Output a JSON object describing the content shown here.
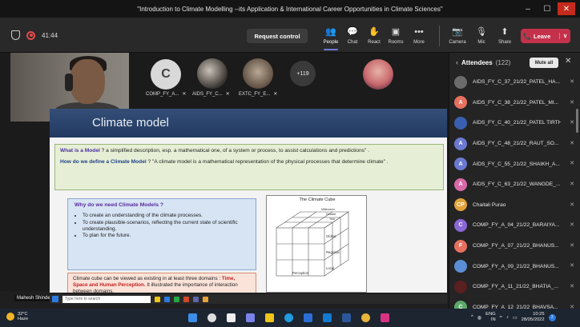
{
  "window": {
    "title": "\"Introduction to Climate Modelling --its Application & International Career Opportunities in Climate Sciences\"",
    "minimize": "–",
    "maximize": "☐",
    "close": "✕"
  },
  "toolbar": {
    "timer": "41:44",
    "request_control": "Request control",
    "items": [
      {
        "label": "People",
        "icon": "👥"
      },
      {
        "label": "Chat",
        "icon": "💬"
      },
      {
        "label": "React",
        "icon": "✋"
      },
      {
        "label": "Rooms",
        "icon": "▣"
      },
      {
        "label": "More",
        "icon": "•••"
      },
      {
        "label": "Camera",
        "icon": "📷"
      },
      {
        "label": "Mic",
        "icon": "🎙"
      },
      {
        "label": "Share",
        "icon": "⬆"
      }
    ],
    "leave": "Leave",
    "leave_icon": "📞",
    "leave_dropdown": "∨"
  },
  "stage": {
    "tiles": [
      {
        "initial": "C",
        "label": "COMP_FY_A..."
      },
      {
        "label": "AIDS_FY_C..."
      },
      {
        "label": "EXTC_FY_E..."
      }
    ],
    "more_count": "+119",
    "presenter_name": "Mahesh Shinde"
  },
  "slide": {
    "title": "Climate model",
    "def1_q": "What is a Model",
    "def1_text": " ? a simplified description, esp. a mathematical one, of a system or process, to assist calculations and predictions\" .",
    "def2_q": "How do we define a Climate Model",
    "def2_text": " ? \"A climate model is a mathematical representation of the physical processes that determine climate\" .",
    "why_title": "Why do we need Climate Models ?",
    "why_items": [
      "To create an understanding of the climate processes.",
      "To create plausible-scenarios, reflecting the current state of scientific understanding.",
      "To plan for the future."
    ],
    "cube_title": "The Climate Cube",
    "cube_labels": {
      "global": "Global",
      "regional": "Regional",
      "local": "Local",
      "perception": "Perception",
      "millennium": "Millennium",
      "decade": "Decade",
      "year": "Year"
    },
    "domains_pre": "Climate cube can be viewed as existing in at least three domains :",
    "domains_hl": "Time, Space and Human Perception.",
    "domains_post": " It illustrated the importance of interaction between domains."
  },
  "inner_taskbar": {
    "search_placeholder": "Type here to search"
  },
  "panel": {
    "title": "Attendees",
    "count": "(122)",
    "mute_all": "Mute all",
    "attendees": [
      {
        "name": "AIDS_FY_C_37_21/22_PATEL_HA...",
        "initial": "",
        "color": "#6b6b6b"
      },
      {
        "name": "AIDS_FY_C_38_21/22_PATEL_MI...",
        "initial": "A",
        "color": "#e8705f"
      },
      {
        "name": "AIDS_FY_C_40_21/22_PATEL TIRTH",
        "initial": "",
        "color": "#3b5fb0"
      },
      {
        "name": "AIDS_FY_C_48_21/22_RAUT_SO...",
        "initial": "A",
        "color": "#6a79d1"
      },
      {
        "name": "AIDS_FY_C_55_21/22_SHAIKH_A...",
        "initial": "A",
        "color": "#6a79d1"
      },
      {
        "name": "AIDS_FY_C_63_21/22_WANGDE_...",
        "initial": "A",
        "color": "#d86aa9"
      },
      {
        "name": "Chaitali Purao",
        "initial": "CP",
        "color": "#e2a23a"
      },
      {
        "name": "COMP_FY_A_04_21/22_BARAIYA...",
        "initial": "C",
        "color": "#8a67d6"
      },
      {
        "name": "COMP_FY_A_07_21/22_BHANUS...",
        "initial": "F",
        "color": "#e8705f"
      },
      {
        "name": "COMP_FY_A_09_21/22_BHANUS...",
        "initial": "",
        "color": "#5a8fd6"
      },
      {
        "name": "COMP_FY_A_11_21/22_BHATIA_...",
        "initial": "",
        "color": "#5a1f1f"
      },
      {
        "name": "COMP_FY_A_12_21/22_BHAVSA...",
        "initial": "C",
        "color": "#5ca86a"
      }
    ]
  },
  "taskbar": {
    "temp": "32°C",
    "condition": "Haze",
    "lang": "ENG",
    "region": "IN",
    "time": "10:25",
    "date": "28/05/2022",
    "notif": "3"
  }
}
